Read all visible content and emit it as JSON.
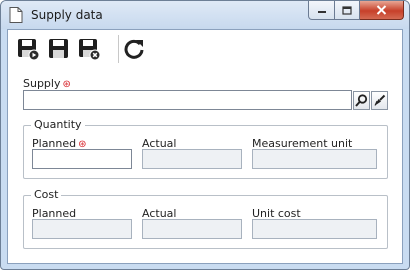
{
  "window": {
    "title": "Supply data"
  },
  "toolbar": {
    "buttons": [
      {
        "icon": "save-and-new-icon"
      },
      {
        "icon": "save-icon"
      },
      {
        "icon": "save-and-close-icon"
      },
      {
        "icon": "refresh-icon"
      }
    ]
  },
  "supply": {
    "label": "Supply",
    "required_mark": "⊛",
    "value": ""
  },
  "quantity": {
    "legend": "Quantity",
    "planned_label": "Planned",
    "required_mark": "⊛",
    "planned_value": "",
    "actual_label": "Actual",
    "actual_value": "",
    "unit_label": "Measurement unit",
    "unit_value": ""
  },
  "cost": {
    "legend": "Cost",
    "planned_label": "Planned",
    "planned_value": "",
    "actual_label": "Actual",
    "actual_value": "",
    "unit_cost_label": "Unit cost",
    "unit_cost_value": ""
  },
  "colors": {
    "required": "#d8262d",
    "frame": "#c9dcf1",
    "close_button": "#c7402a"
  }
}
